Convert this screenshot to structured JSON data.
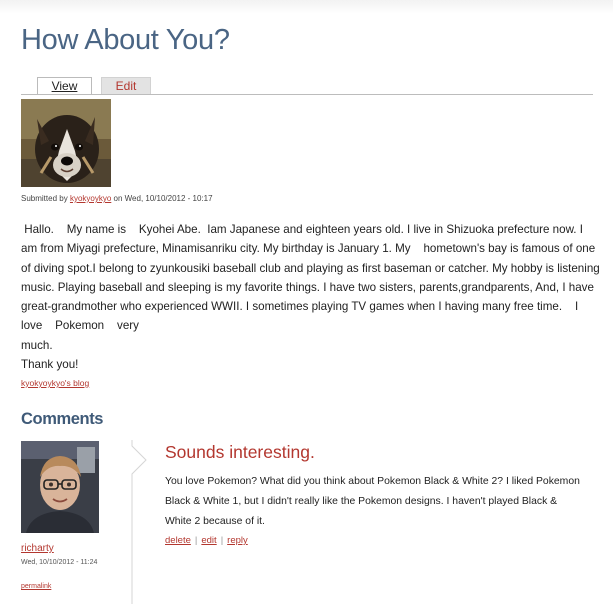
{
  "page": {
    "title": "How About You?"
  },
  "tabs": [
    {
      "label": "View",
      "active": true
    },
    {
      "label": "Edit",
      "active": false
    }
  ],
  "submitted": {
    "prefix": "Submitted by",
    "author": "kyokyoykyo",
    "date": "on Wed, 10/10/2012 - 10:17"
  },
  "body": {
    "paragraphs": [
      " Hallo.    My name is    Kyohei Abe.  Iam Japanese and eighteen years old. I live in Shizuoka prefecture now. I am from Miyagi prefecture, Minamisanriku city. My birthday is January 1. My    hometown's bay is famous of one of diving spot.I belong to zyunkousiki baseball club and playing as first baseman or catcher. My hobby is listening music. Playing baseball and sleeping is my favorite things. I have two sisters, parents,grandparents, And, I have great-grandmother who experienced WWII. I sometimes playing TV games when I having many free time.    I love    Pokemon    very",
      "much.",
      "Thank you!"
    ],
    "blog_link": "kyokyoykyo's blog"
  },
  "comments_heading": "Comments",
  "comment": {
    "author": "richarty",
    "date": "Wed, 10/10/2012 - 11:24",
    "permalink": "permalink",
    "title": "Sounds interesting.",
    "body": "You love Pokemon? What did you think about Pokemon Black & White 2? I liked Pokemon Black & White 1, but I didn't really like the Pokemon designs. I haven't played Black & White 2 because of it.",
    "links": [
      "delete",
      "edit",
      "reply"
    ]
  },
  "colors": {
    "title_blue": "#4a6584",
    "link_red": "#b3372f",
    "comments_heading": "#3f5a78"
  },
  "icons": {
    "post_image": "dog-photo",
    "comment_avatar": "user-avatar-photo"
  }
}
